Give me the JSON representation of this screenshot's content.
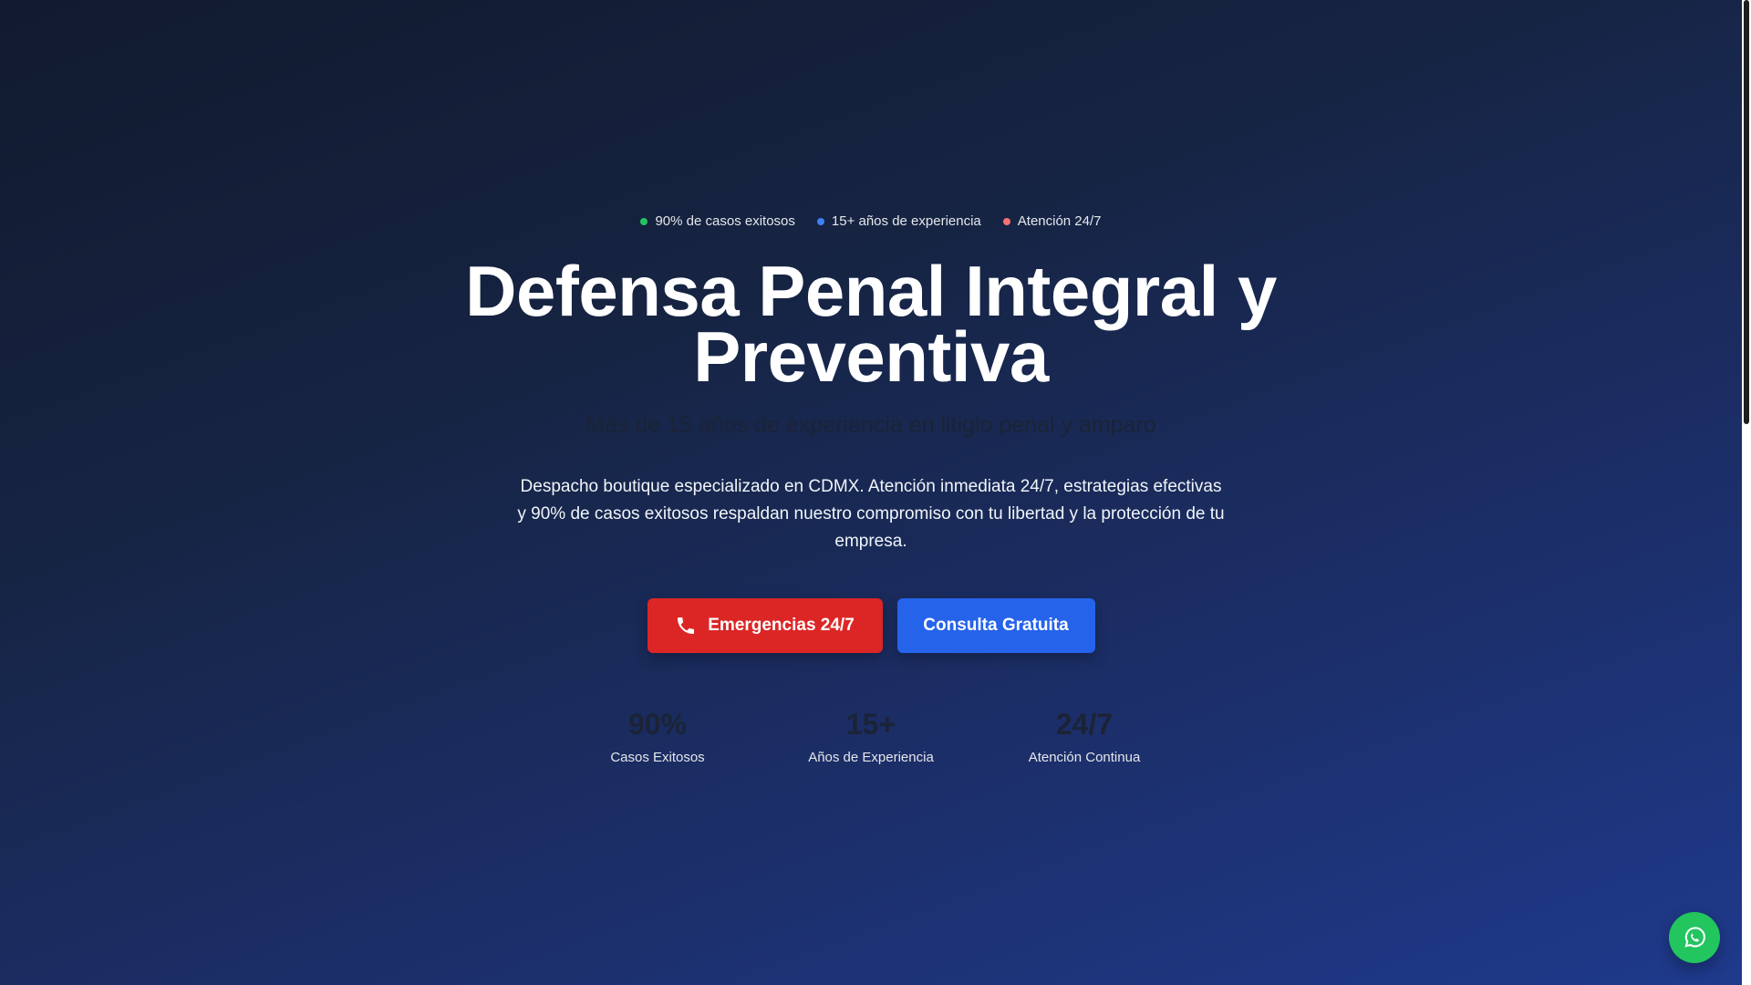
{
  "badges": [
    {
      "label": "90% de casos exitosos",
      "color": "#22c55e"
    },
    {
      "label": "15+ años de experiencia",
      "color": "#3b82f6"
    },
    {
      "label": "Atención 24/7",
      "color": "#f87171"
    }
  ],
  "hero": {
    "title_line1": "Defensa Penal Integral y",
    "title_line2": "Preventiva",
    "subtitle": "Más de 15 años de experiencia en litigio penal y amparo",
    "description": "Despacho boutique especializado en CDMX. Atención inmediata 24/7, estrategias efectivas y 90% de casos exitosos respaldan nuestro compromiso con tu libertad y la protección de tu empresa."
  },
  "buttons": {
    "emergency_label": "Emergencias 24/7",
    "emergency_icon": "phone-icon",
    "emergency_color": "#dc2626",
    "consult_label": "Consulta Gratuita",
    "consult_color": "#2563eb"
  },
  "stats": [
    {
      "value": "90%",
      "label": "Casos Exitosos"
    },
    {
      "value": "15+",
      "label": "Años de Experiencia"
    },
    {
      "value": "24/7",
      "label": "Atención Continua"
    }
  ],
  "floating": {
    "icon": "whatsapp-icon",
    "color": "#22c55e"
  }
}
